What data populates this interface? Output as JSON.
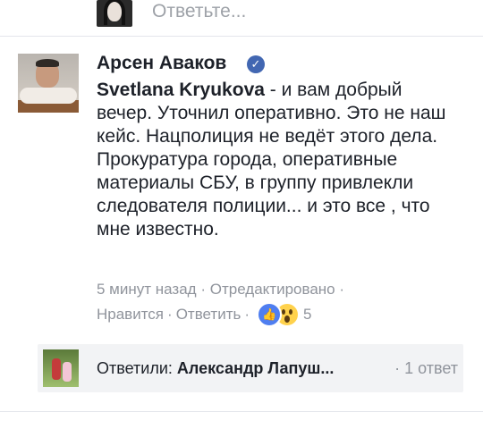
{
  "reply_box": {
    "placeholder": "Ответьте..."
  },
  "comment": {
    "author": "Арсен Аваков",
    "mention": "Svetlana Kryukova",
    "text": " - и вам добрый вечер.  Уточнил оперативно. Это не наш кейс.  Нацполиция не ведёт этого дела. Прокуратура города, оперативные материалы СБУ, в группу привлекли  следователя полиции... и это все , что мне известно.",
    "time": "5 минут назад",
    "edited": "Отредактировано",
    "like_label": "Нравится",
    "reply_label": "Ответить",
    "reaction_count": "5",
    "separator": "·"
  },
  "replies": {
    "label": "Ответили:",
    "who": "Александр Лапуш...",
    "count": "· 1 ответ"
  },
  "colors": {
    "accent": "#4267b2",
    "muted_text": "#90949c",
    "text": "#1d2129"
  }
}
